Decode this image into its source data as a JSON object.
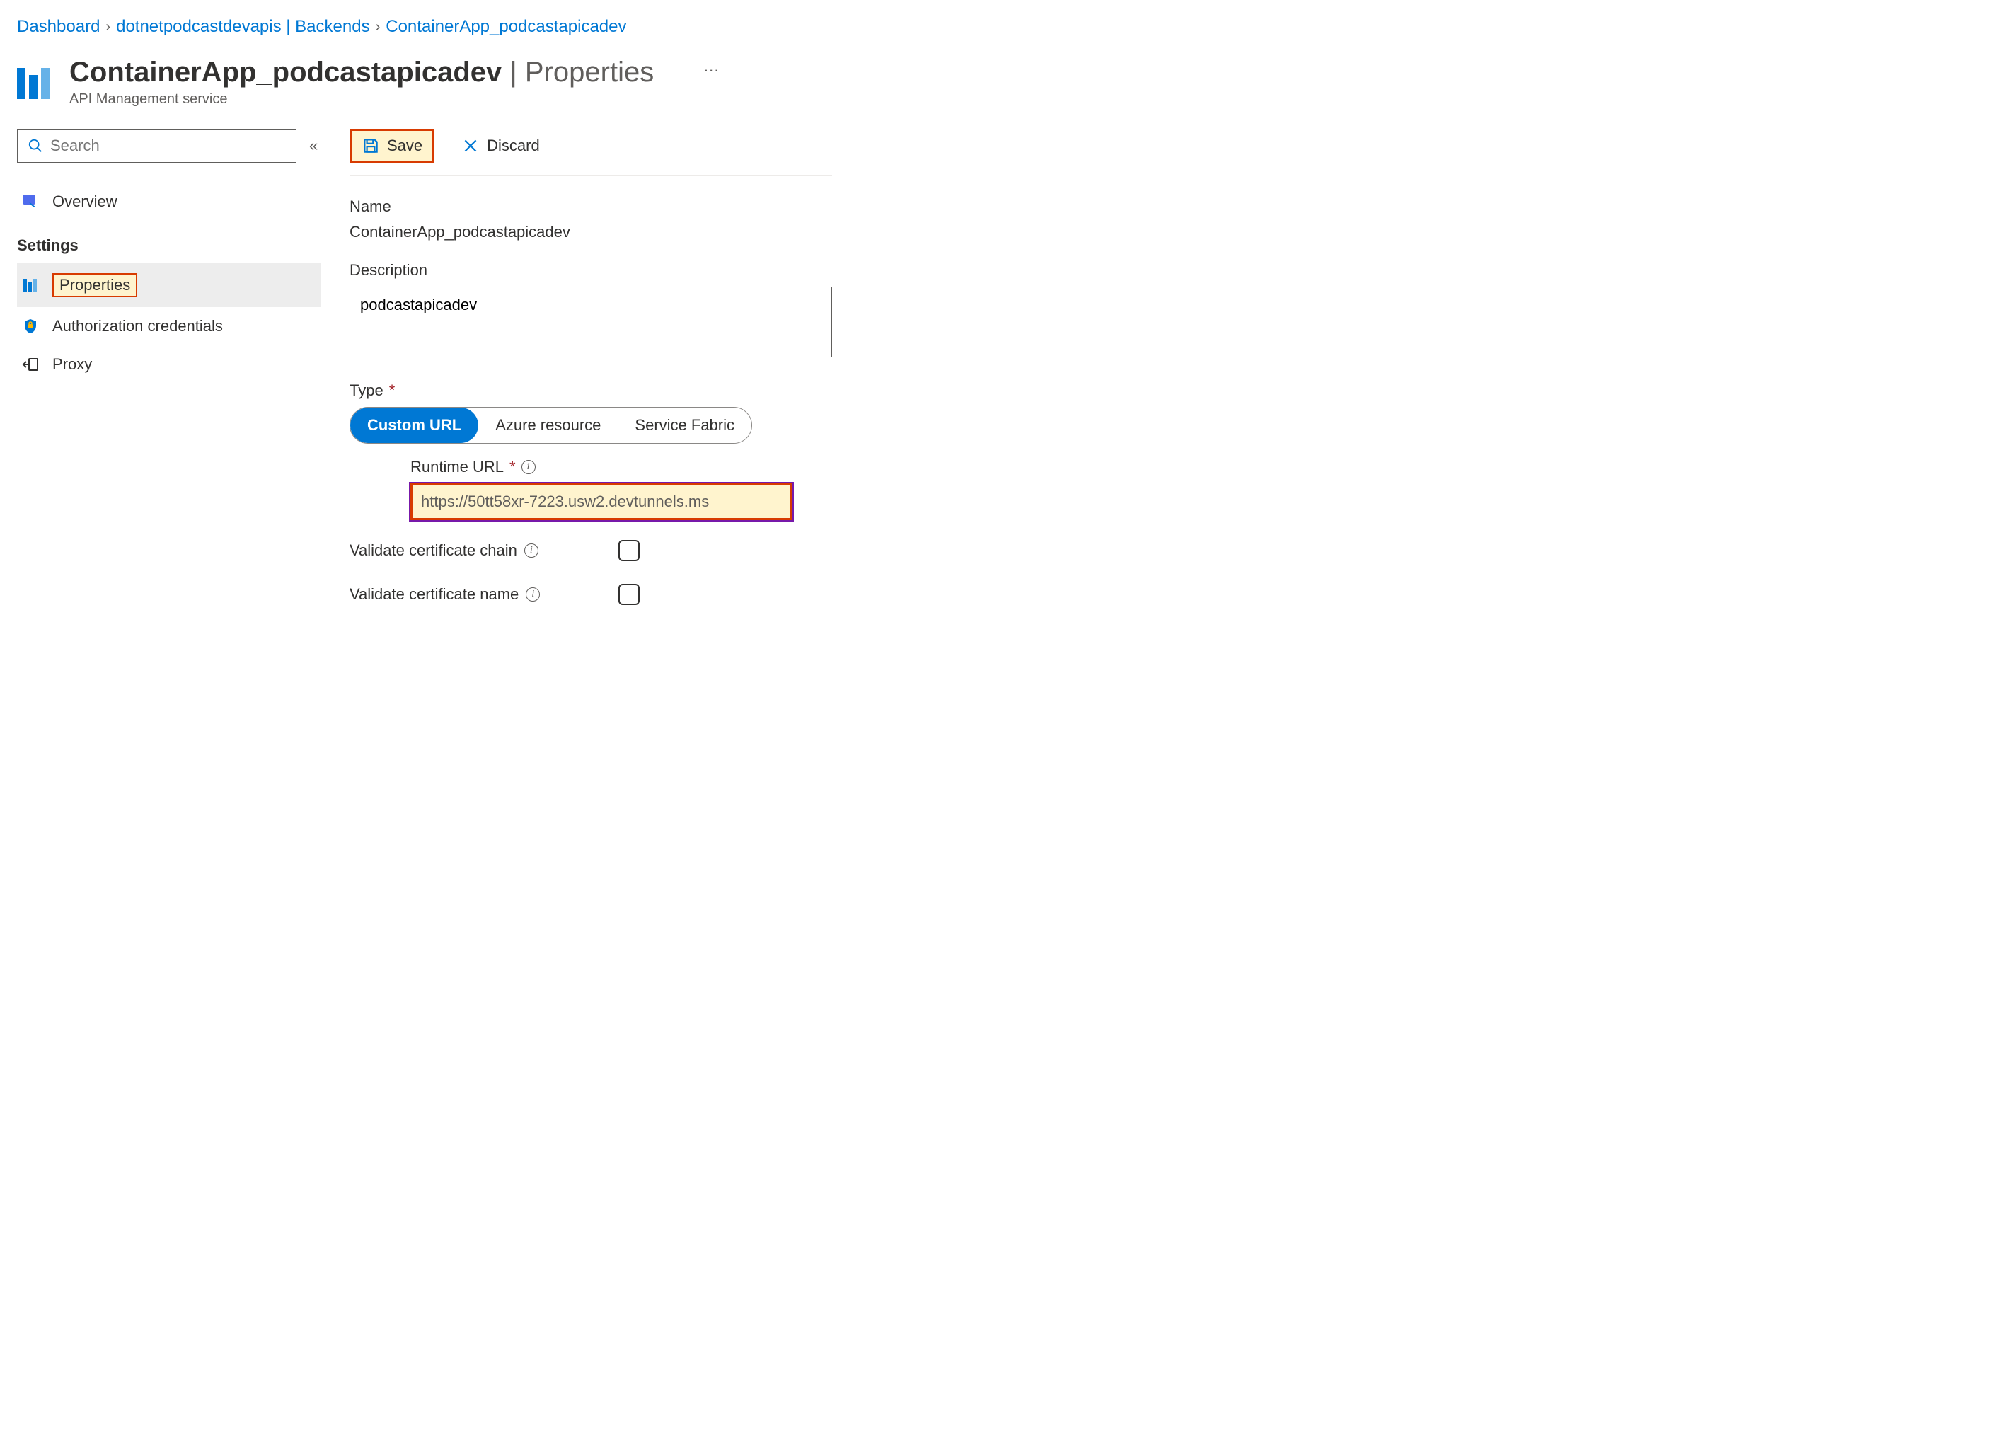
{
  "breadcrumbs": {
    "dashboard": "Dashboard",
    "backends": "dotnetpodcastdevapis | Backends",
    "current": "ContainerApp_podcastapicadev"
  },
  "header": {
    "title_resource": "ContainerApp_podcastapicadev",
    "title_suffix": "Properties",
    "subtitle": "API Management service",
    "more_symbol": "···"
  },
  "search": {
    "placeholder": "Search",
    "collapse_symbol": "«"
  },
  "sidebar": {
    "overview": "Overview",
    "settings_heading": "Settings",
    "properties": "Properties",
    "auth": "Authorization credentials",
    "proxy": "Proxy"
  },
  "toolbar": {
    "save_label": "Save",
    "discard_label": "Discard"
  },
  "form": {
    "name_label": "Name",
    "name_value": "ContainerApp_podcastapicadev",
    "description_label": "Description",
    "description_value": "podcastapicadev",
    "type_label": "Type",
    "type_options": {
      "custom": "Custom URL",
      "azure": "Azure resource",
      "fabric": "Service Fabric"
    },
    "runtime_label": "Runtime URL",
    "runtime_value": "https://50tt58xr-7223.usw2.devtunnels.ms",
    "validate_chain": "Validate certificate chain",
    "validate_name": "Validate certificate name",
    "required_mark": "*"
  }
}
